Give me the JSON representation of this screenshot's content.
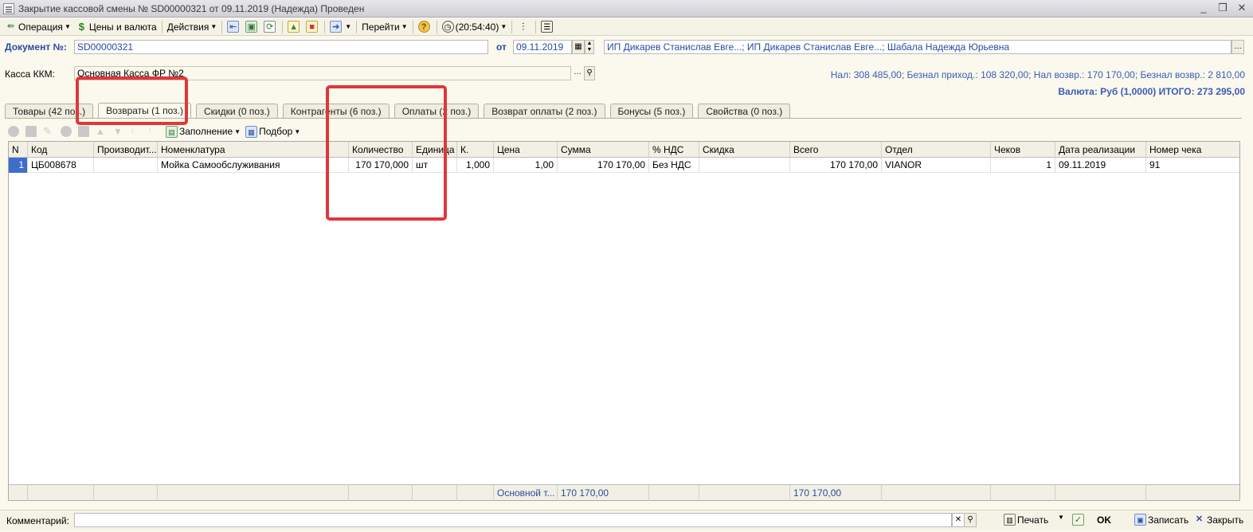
{
  "window": {
    "title": "Закрытие кассовой смены № SD00000321 от 09.11.2019 (Надежда) Проведен"
  },
  "toolbar": {
    "operation": "Операция",
    "prices_currency": "Цены и валюта",
    "actions": "Действия",
    "go_to": "Перейти",
    "time": "(20:54:40)"
  },
  "document": {
    "number_label": "Документ №:",
    "number_value": "SD00000321",
    "date_label": "от",
    "date_value": "09.11.2019",
    "responsible": "ИП Дикарев Станислав Евге...; ИП Дикарев Станислав Евге...; Шабала Надежда Юрьевна"
  },
  "kkm": {
    "label": "Касса ККМ:",
    "value": "Основная Касса ФР №2"
  },
  "totals": {
    "line1": "Нал: 308 485,00; Безнал приход.: 108 320,00; Нал возвр.: 170 170,00; Безнал возвр.: 2 810,00",
    "line2": "Валюта: Руб (1,0000) ИТОГО: 273 295,00"
  },
  "tabs": [
    {
      "label": "Товары (42 поз.)"
    },
    {
      "label": "Возвраты (1 поз.)"
    },
    {
      "label": "Скидки (0 поз.)"
    },
    {
      "label": "Контрагенты (6 поз.)"
    },
    {
      "label": "Оплаты (2 поз.)"
    },
    {
      "label": "Возврат оплаты (2 поз.)"
    },
    {
      "label": "Бонусы (5 поз.)"
    },
    {
      "label": "Свойства (0 поз.)"
    }
  ],
  "subtoolbar": {
    "fill": "Заполнение",
    "select": "Подбор"
  },
  "table": {
    "columns": [
      "N",
      "Код",
      "Производит...",
      "Номенклатура",
      "Количество",
      "Единица",
      "К.",
      "Цена",
      "Сумма",
      "% НДС",
      "Скидка",
      "Всего",
      "Отдел",
      "Чеков",
      "Дата реализации",
      "Номер чека"
    ],
    "rows": [
      [
        "1",
        "ЦБ008678",
        "",
        "Мойка Самообслуживания",
        "170 170,000",
        "шт",
        "1,000",
        "1,00",
        "170 170,00",
        "Без НДС",
        "",
        "170 170,00",
        "VIANOR",
        "1",
        "09.11.2019",
        "91"
      ]
    ],
    "footer": {
      "price": "Основной т...",
      "sum": "170 170,00",
      "total": "170 170,00"
    }
  },
  "bottom": {
    "comment_label": "Комментарий:",
    "comment_value": "",
    "print": "Печать",
    "ok": "OK",
    "save": "Записать",
    "close": "Закрыть"
  },
  "colors": {
    "accent_blue": "#2a4aa0",
    "highlight_red": "#e0373a",
    "selection": "#3b6fc9"
  }
}
